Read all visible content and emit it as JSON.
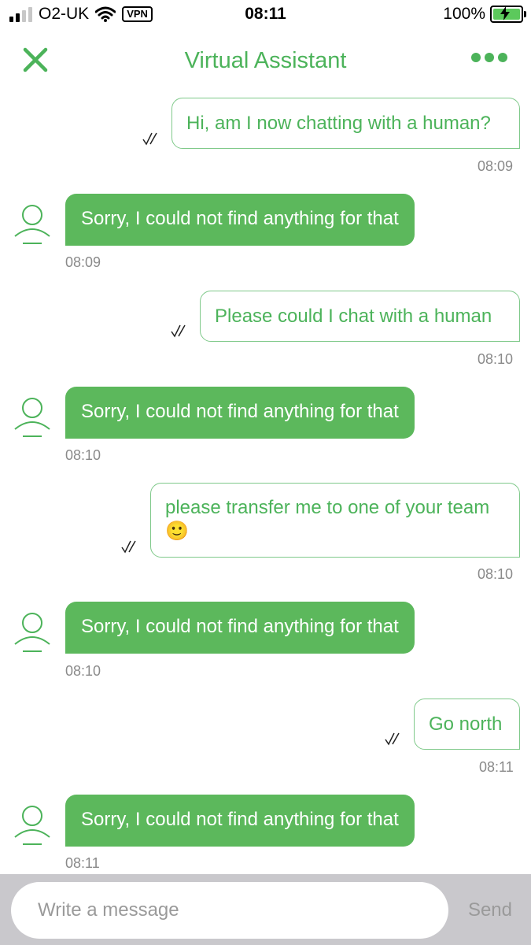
{
  "status_bar": {
    "carrier": "O2-UK",
    "vpn": "VPN",
    "time": "08:11",
    "battery": "100%"
  },
  "header": {
    "title": "Virtual Assistant",
    "accent_color": "#4cb35a"
  },
  "messages": [
    {
      "sender": "user",
      "text": "Hi, am I now chatting with a human?",
      "time": "08:09"
    },
    {
      "sender": "bot",
      "text": "Sorry, I could not find anything for that",
      "time": "08:09"
    },
    {
      "sender": "user",
      "text": "Please could I chat with a human",
      "time": "08:10"
    },
    {
      "sender": "bot",
      "text": "Sorry, I could not find anything for that",
      "time": "08:10"
    },
    {
      "sender": "user",
      "text": "please transfer me to one of your team",
      "emoji": "🙂",
      "time": "08:10"
    },
    {
      "sender": "bot",
      "text": "Sorry, I could not find anything for that",
      "time": "08:10"
    },
    {
      "sender": "user",
      "text": "Go north",
      "time": "08:11"
    },
    {
      "sender": "bot",
      "text": "Sorry, I could not find anything for that",
      "time": "08:11"
    }
  ],
  "composer": {
    "placeholder": "Write a message",
    "send_label": "Send"
  }
}
